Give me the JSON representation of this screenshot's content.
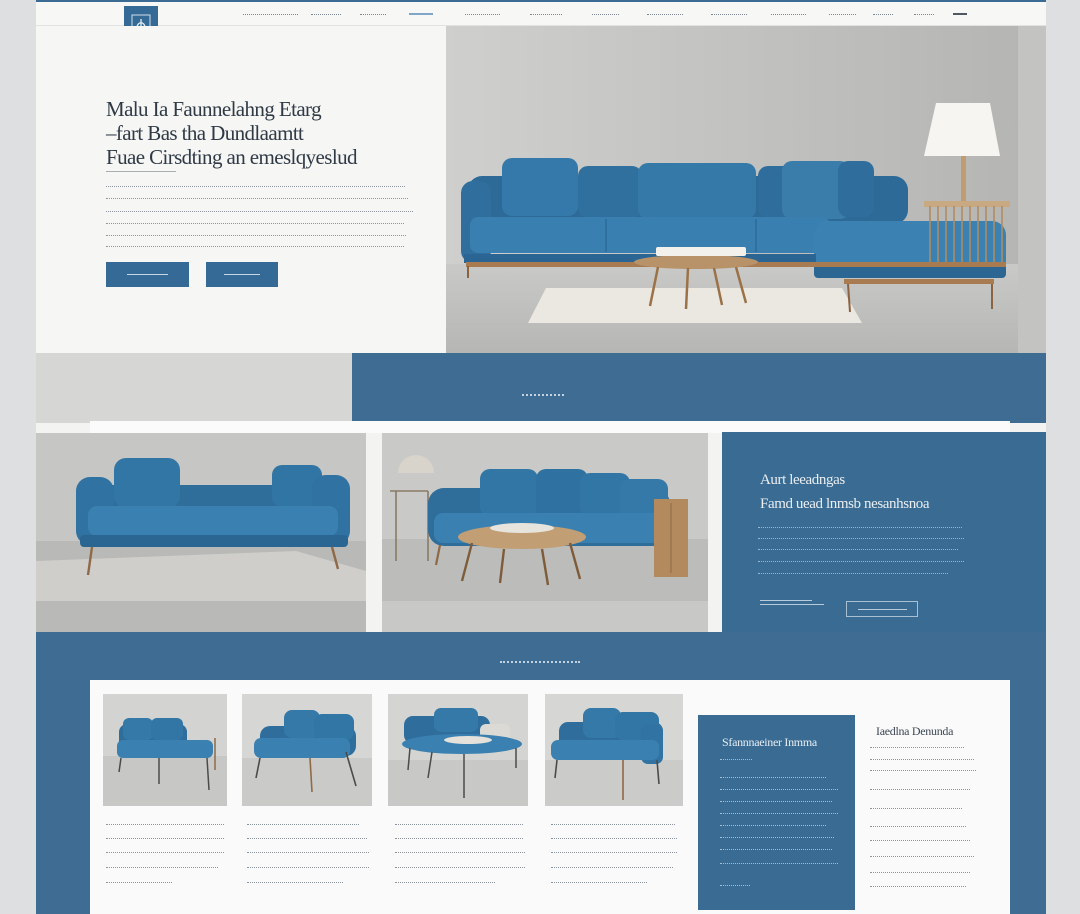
{
  "brand": {
    "accent": "#356a96",
    "band": "#3e6c92",
    "background": "#f3f3f2"
  },
  "nav": {
    "logo_icon": "monogram-logo-icon"
  },
  "hero": {
    "title_lines": [
      "Malu Ia Faunnelahng Etarg",
      "–fart Bas tha Dundlaamtt",
      "Fuae Cirsdting an emeslqyeslud"
    ]
  },
  "feature": {
    "title_lines": [
      "Aurt leeadngas",
      "Famd uead lnmsb nesanhsnoa"
    ]
  },
  "bottom": {
    "promo_title": "Sfannnaeiner Inmma",
    "side_title": "Iaedlna Denunda"
  }
}
